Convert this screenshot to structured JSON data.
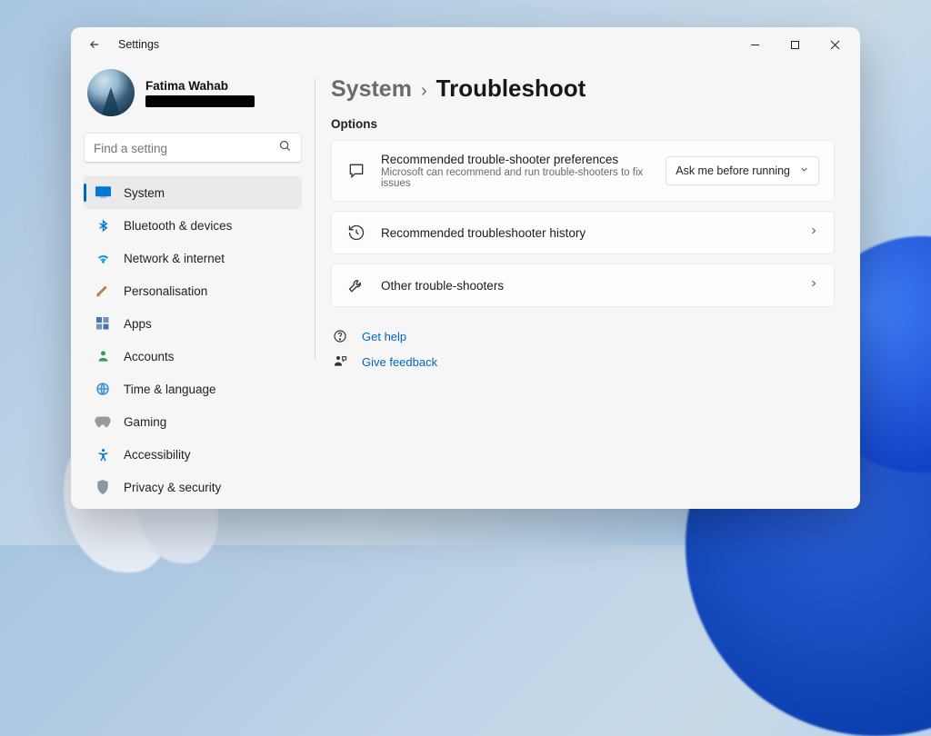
{
  "window": {
    "title": "Settings"
  },
  "profile": {
    "name": "Fatima Wahab"
  },
  "search": {
    "placeholder": "Find a setting"
  },
  "sidebar": {
    "items": [
      {
        "label": "System"
      },
      {
        "label": "Bluetooth & devices"
      },
      {
        "label": "Network & internet"
      },
      {
        "label": "Personalisation"
      },
      {
        "label": "Apps"
      },
      {
        "label": "Accounts"
      },
      {
        "label": "Time & language"
      },
      {
        "label": "Gaming"
      },
      {
        "label": "Accessibility"
      },
      {
        "label": "Privacy & security"
      }
    ]
  },
  "breadcrumb": {
    "parent": "System",
    "sep": "›",
    "current": "Troubleshoot"
  },
  "section": "Options",
  "cards": {
    "prefs": {
      "title": "Recommended trouble-shooter preferences",
      "desc": "Microsoft can recommend and run trouble-shooters to fix issues",
      "dropdown": "Ask me before running"
    },
    "history": {
      "title": "Recommended troubleshooter history"
    },
    "other": {
      "title": "Other trouble-shooters"
    }
  },
  "links": {
    "help": "Get help",
    "feedback": "Give feedback"
  }
}
